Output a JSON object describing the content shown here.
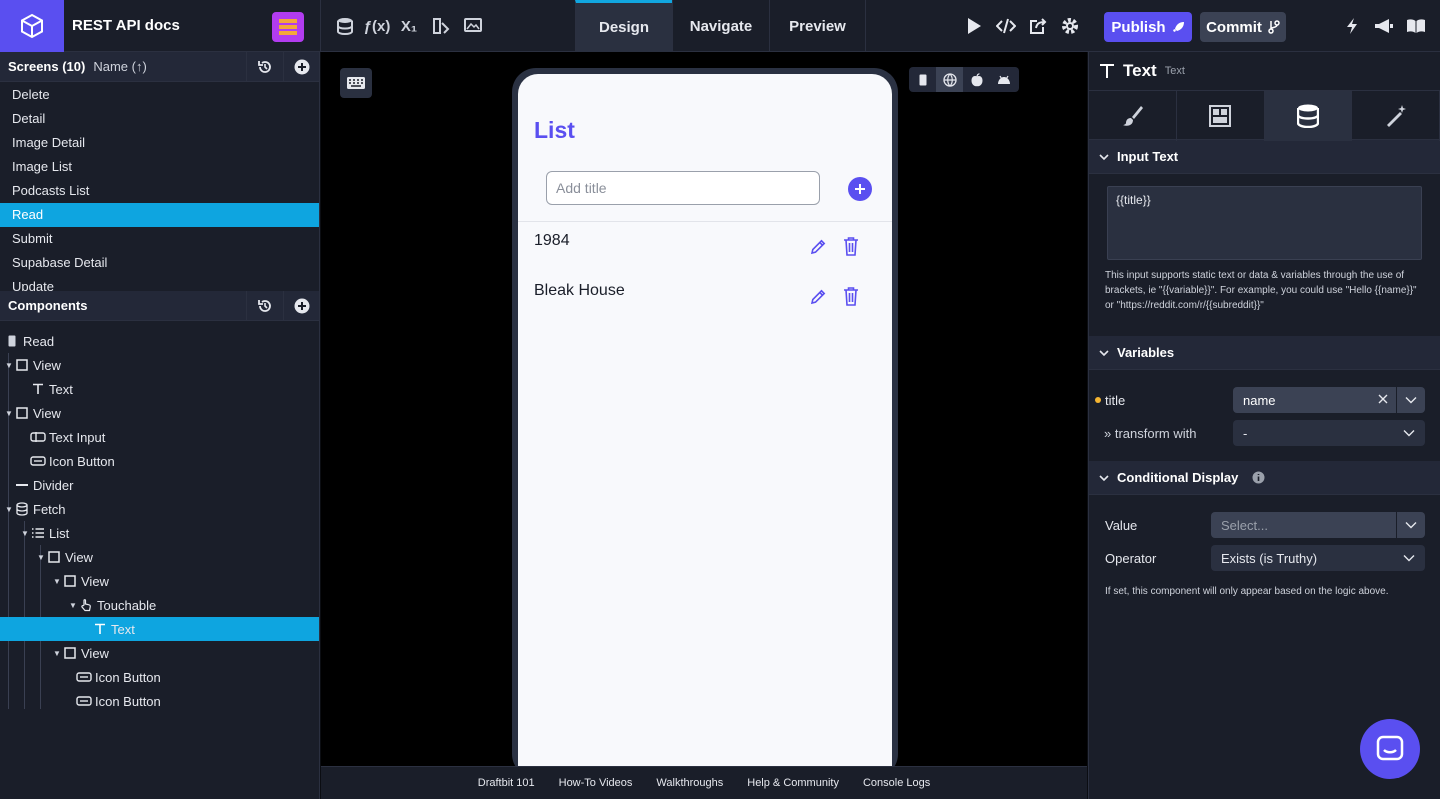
{
  "app": {
    "title": "REST API docs"
  },
  "modes": [
    "Design",
    "Navigate",
    "Preview"
  ],
  "toolbar": {
    "publish_label": "Publish",
    "commit_label": "Commit"
  },
  "screens": {
    "header": "Screens (10)",
    "sort": "Name (↑)",
    "items": [
      "Delete",
      "Detail",
      "Image Detail",
      "Image List",
      "Podcasts List",
      "Read",
      "Submit",
      "Supabase Detail",
      "Update"
    ],
    "selected": "Read"
  },
  "components": {
    "header": "Components",
    "tree": [
      {
        "label": "Read",
        "icon": "phone-icon",
        "depth": 0
      },
      {
        "label": "View",
        "icon": "view-icon",
        "depth": 0
      },
      {
        "label": "Text",
        "icon": "text-icon",
        "depth": 1
      },
      {
        "label": "View",
        "icon": "view-icon",
        "depth": 0
      },
      {
        "label": "Text Input",
        "icon": "text-input-icon",
        "depth": 1
      },
      {
        "label": "Icon Button",
        "icon": "icon-button-icon",
        "depth": 1
      },
      {
        "label": "Divider",
        "icon": "divider-icon",
        "depth": 0
      },
      {
        "label": "Fetch",
        "icon": "database-icon",
        "depth": 0
      },
      {
        "label": "List",
        "icon": "list-icon",
        "depth": 1
      },
      {
        "label": "View",
        "icon": "view-icon",
        "depth": 2
      },
      {
        "label": "View",
        "icon": "view-icon",
        "depth": 3
      },
      {
        "label": "Touchable",
        "icon": "touchable-icon",
        "depth": 4
      },
      {
        "label": "Text",
        "icon": "text-icon",
        "depth": 5
      },
      {
        "label": "View",
        "icon": "view-icon",
        "depth": 3
      },
      {
        "label": "Icon Button",
        "icon": "icon-button-icon",
        "depth": 4
      },
      {
        "label": "Icon Button",
        "icon": "icon-button-icon",
        "depth": 4
      }
    ]
  },
  "preview": {
    "title": "List",
    "input_placeholder": "Add title",
    "rows": [
      "1984",
      "Bleak House"
    ]
  },
  "footer": [
    "Draftbit 101",
    "How-To Videos",
    "Walkthroughs",
    "Help & Community",
    "Console Logs"
  ],
  "inspector": {
    "title": "Text",
    "subtitle": "Text",
    "input_section": "Input Text",
    "input_value": "{{title}}",
    "input_help": "This input supports static text or data & variables through the use of brackets, ie \"{{variable}}\". For example, you could use \"Hello {{name}}\" or \"https://reddit.com/r/{{subreddit}}\"",
    "variables_section": "Variables",
    "var_name": "title",
    "var_value": "name",
    "transform_label": "» transform with",
    "transform_value": "-",
    "conditional_section": "Conditional Display",
    "value_label": "Value",
    "value_placeholder": "Select...",
    "operator_label": "Operator",
    "operator_value": "Exists (is Truthy)",
    "conditional_help": "If set, this component will only appear based on the logic above."
  },
  "colors": {
    "accent": "#5a4ff0",
    "selection": "#0ea5e0",
    "panel": "#1a1e29"
  }
}
